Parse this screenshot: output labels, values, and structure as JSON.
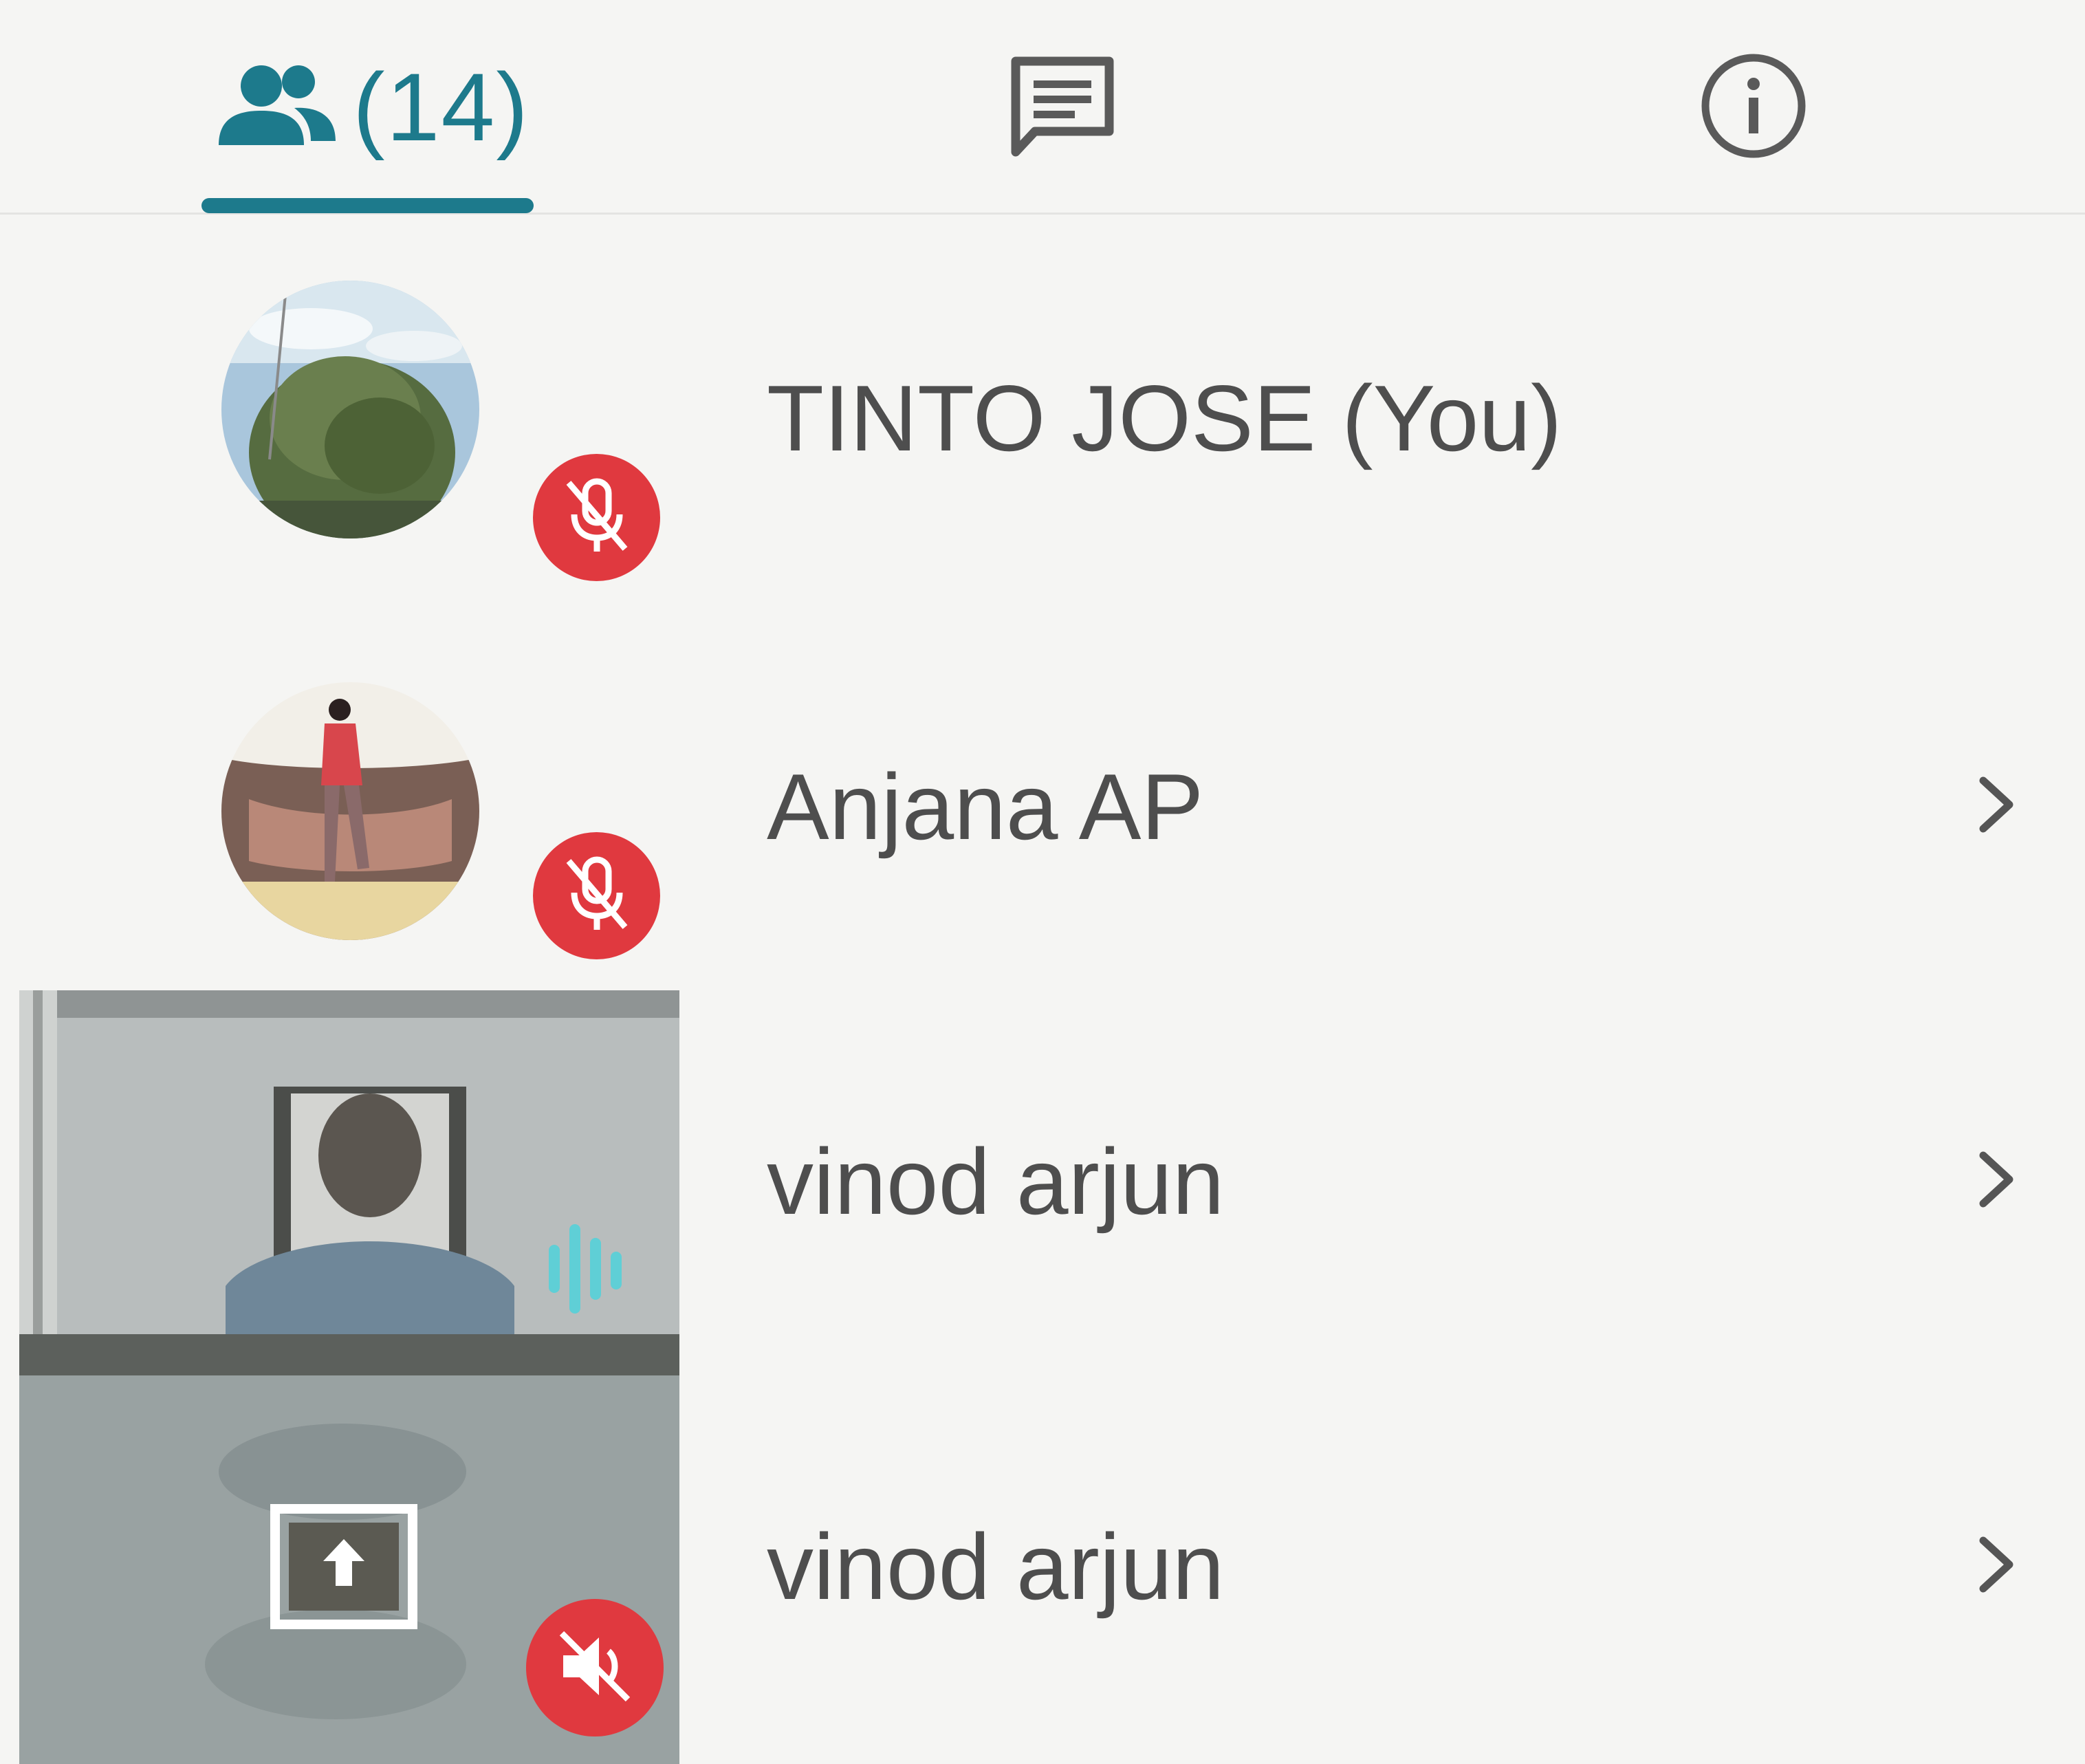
{
  "tabs": {
    "participants_count": "(14)",
    "active": "participants"
  },
  "participants": [
    {
      "name": "TINTO JOSE (You)",
      "mic": "muted",
      "has_chevron": false
    },
    {
      "name": "Anjana AP",
      "mic": "muted",
      "has_chevron": true
    },
    {
      "name": "vinod arjun",
      "mic": "speaking",
      "has_chevron": true
    },
    {
      "name": "vinod arjun",
      "mic": "audio-off",
      "has_chevron": true
    }
  ],
  "colors": {
    "accent": "#1d7a8c",
    "mute_badge": "#e0393f",
    "text": "#4e4e4e",
    "speaking_bars": "#5fcfd6"
  }
}
